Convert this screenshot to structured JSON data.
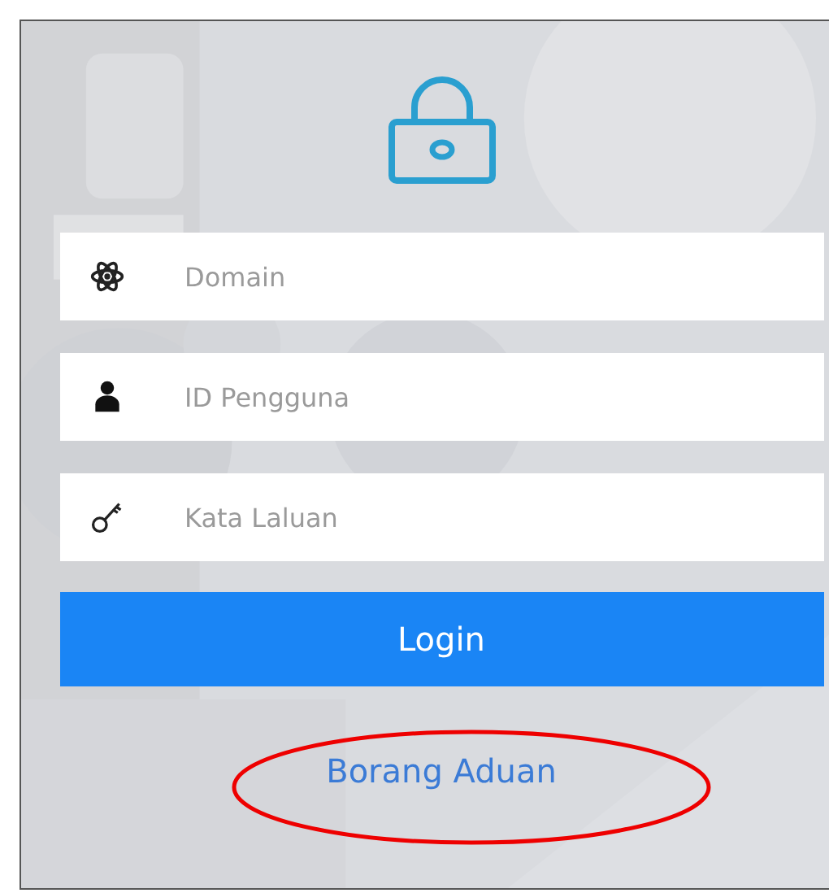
{
  "fields": [
    {
      "placeholder": "Domain"
    },
    {
      "placeholder": "ID Pengguna"
    },
    {
      "placeholder": "Kata Laluan"
    }
  ],
  "login_button": {
    "label": "Login"
  },
  "link": {
    "label": "Borang Aduan",
    "circled": true
  }
}
